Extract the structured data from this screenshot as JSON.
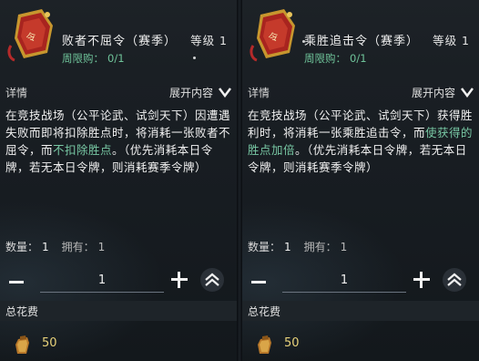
{
  "panels": [
    {
      "emblem_icon": "red-gold-badge-token",
      "name": "败者不屈令（赛季）",
      "level": "等级 1",
      "limit_label": "周限购：",
      "limit_value": "0/1",
      "details_label": "详情",
      "expand_label": "展开内容",
      "desc_parts": [
        "在竞技战场（公平论武、试剑天下）因遭遇失败而即将扣除胜点时，将消耗一张败者不屈令，而",
        "不扣除胜点",
        "。（优先消耗本日令牌，若无本日令牌，则消耗赛季令牌）"
      ],
      "qty_label": "数量：",
      "qty_value": "1",
      "own_label": "拥有：",
      "own_value": "1",
      "input_value": "1",
      "total_label": "总花费",
      "cost_icon": "coin-pouch-icon",
      "cost_value": "50"
    },
    {
      "emblem_icon": "red-gold-badge-token",
      "name": "乘胜追击令（赛季）",
      "level": "等级 1",
      "limit_label": "周限购：",
      "limit_value": "0/1",
      "details_label": "详情",
      "expand_label": "展开内容",
      "desc_parts": [
        "在竞技战场（公平论武、试剑天下）获得胜利时，将消耗一张乘胜追击令，而",
        "使获得的胜点加倍",
        "。（优先消耗本日令牌，若无本日令牌，则消耗赛季令牌）"
      ],
      "qty_label": "数量：",
      "qty_value": "1",
      "own_label": "拥有：",
      "own_value": "1",
      "input_value": "1",
      "total_label": "总花费",
      "cost_icon": "coin-pouch-icon",
      "cost_value": "50"
    }
  ],
  "colors": {
    "highlight_green": "#78c8a4",
    "limit_green": "#6fc49a",
    "cost_gold": "#e8d27a"
  }
}
